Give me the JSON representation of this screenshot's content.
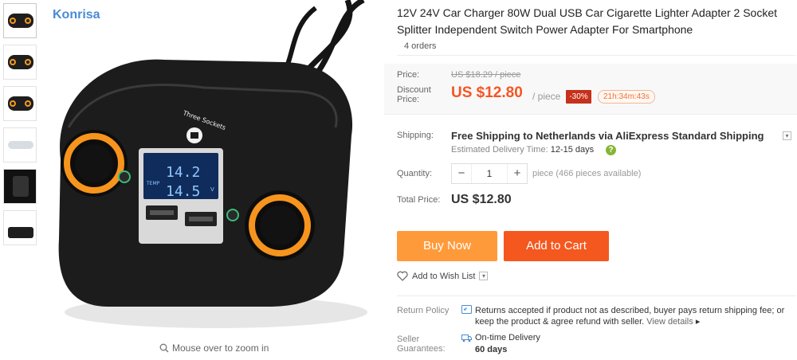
{
  "brand": "Konrisa",
  "thumbnails": [
    "thumb-1",
    "thumb-2",
    "thumb-3",
    "thumb-4",
    "thumb-5",
    "thumb-6"
  ],
  "main_image": {
    "label_three_sockets": "Three Sockets",
    "display_line1": "14.2",
    "display_line2": "14.5",
    "display_unit": "V",
    "display_temp": "TEMP",
    "zoom_hint": "Mouse over to zoom in"
  },
  "product": {
    "title": "12V 24V Car Charger 80W Dual USB Car Cigarette Lighter Adapter 2 Socket Splitter Independent Switch Power Adapter For Smartphone",
    "orders": "4 orders"
  },
  "price": {
    "price_label": "Price:",
    "old_price": "US $18.29 / piece",
    "discount_label": "Discount Price:",
    "current_price": "US $12.80",
    "per_piece": "/ piece",
    "discount_badge": "-30%",
    "countdown": "21h:34m:43s"
  },
  "shipping": {
    "label": "Shipping:",
    "text": "Free Shipping to Netherlands via AliExpress Standard Shipping",
    "eta_label": "Estimated Delivery Time:",
    "eta_value": "12-15",
    "eta_unit": "days"
  },
  "quantity": {
    "label": "Quantity:",
    "minus": "−",
    "value": "1",
    "plus": "+",
    "info": "piece (466 pieces available)"
  },
  "total": {
    "label": "Total Price:",
    "value": "US $12.80"
  },
  "actions": {
    "buy_now": "Buy Now",
    "add_to_cart": "Add to Cart",
    "wishlist": "Add to Wish List"
  },
  "return_policy": {
    "label": "Return Policy",
    "text": "Returns accepted if product not as described, buyer pays return shipping fee; or keep the product & agree refund with seller.",
    "link": "View details"
  },
  "guarantee": {
    "label": "Seller Guarantees:",
    "text": "On-time Delivery",
    "days": "60 days"
  },
  "colors": {
    "accent_price": "#f55523",
    "buy_now": "#ff9a3b",
    "add_to_cart": "#f4581f",
    "discount_badge": "#c7301a",
    "brand": "#4a8bd4"
  }
}
